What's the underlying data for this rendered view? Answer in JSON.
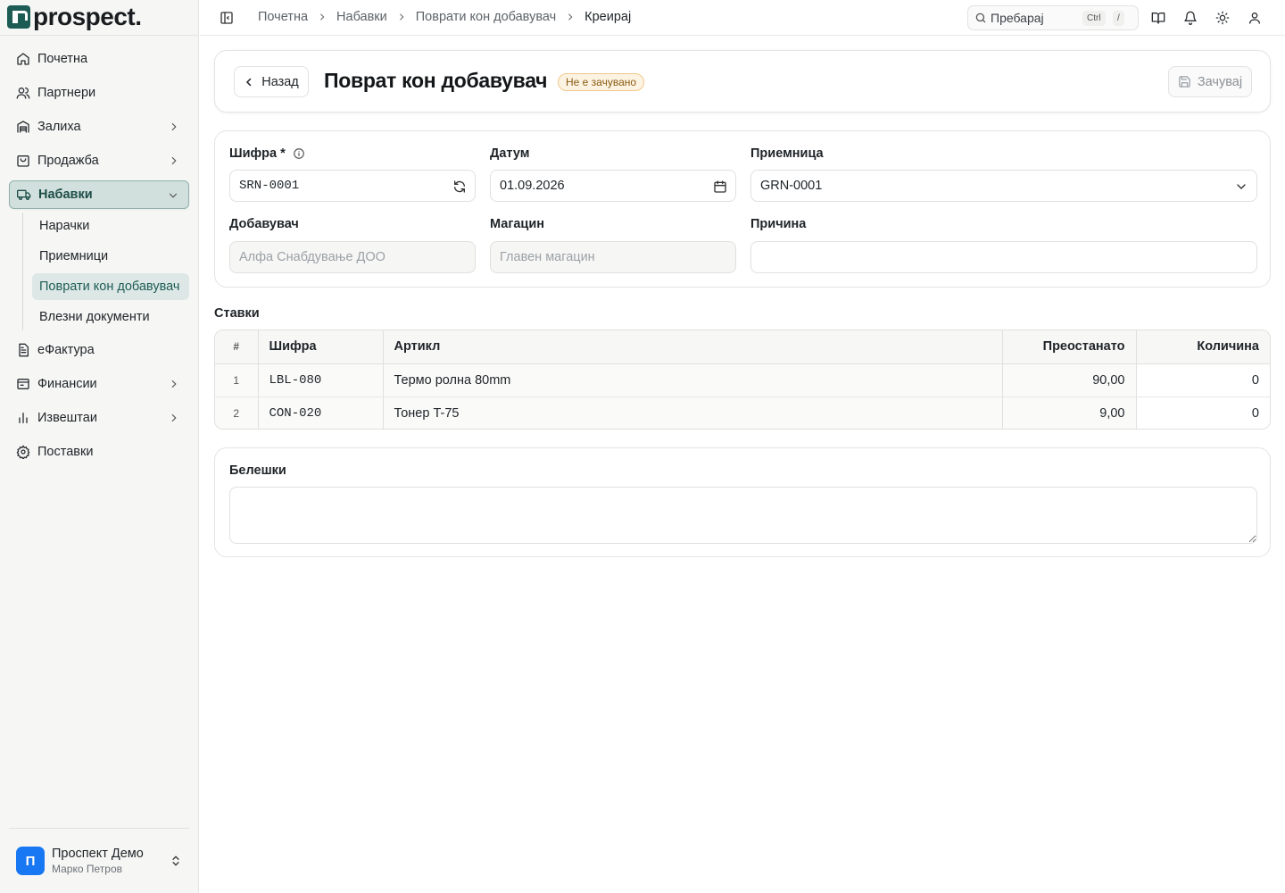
{
  "app": {
    "name": "prospect."
  },
  "sidebar": {
    "items": [
      {
        "label": "Почетна",
        "icon": "home-icon"
      },
      {
        "label": "Партнери",
        "icon": "users-icon"
      },
      {
        "label": "Залиха",
        "icon": "warehouse-icon"
      },
      {
        "label": "Продажба",
        "icon": "shopping-bag-icon"
      },
      {
        "label": "Набавки",
        "icon": "truck-icon"
      },
      {
        "label": "еФактура",
        "icon": "file-text-icon"
      },
      {
        "label": "Финансии",
        "icon": "wallet-icon"
      },
      {
        "label": "Извештаи",
        "icon": "bar-chart-icon"
      },
      {
        "label": "Поставки",
        "icon": "settings-icon"
      }
    ],
    "procurement_sub": [
      {
        "label": "Нарачки"
      },
      {
        "label": "Приемници"
      },
      {
        "label": "Поврати кон добавувач"
      },
      {
        "label": "Влезни документи"
      }
    ],
    "account": {
      "name": "Проспект Демо",
      "user": "Марко Петров",
      "initial": "П"
    }
  },
  "topbar": {
    "breadcrumbs": [
      "Почетна",
      "Набавки",
      "Поврати кон добавувач",
      "Креирај"
    ],
    "search_placeholder": "Пребарај",
    "kbd_ctrl": "Ctrl",
    "kbd_slash": "/"
  },
  "header": {
    "back_label": "Назад",
    "title": "Поврат кон добавувач",
    "status_badge": "Не е зачувано",
    "save_label": "Зачувај"
  },
  "form": {
    "code_label": "Шифра *",
    "code_value": "SRN-0001",
    "date_label": "Датум",
    "date_value": "01.09.2026",
    "grn_label": "Приемница",
    "grn_value": "GRN-0001",
    "supplier_label": "Добавувач",
    "supplier_value": "Алфа Снабдување ДОО",
    "warehouse_label": "Магацин",
    "warehouse_value": "Главен магацин",
    "reason_label": "Причина",
    "reason_value": ""
  },
  "items": {
    "section_label": "Ставки",
    "columns": [
      "#",
      "Шифра",
      "Артикл",
      "Преостанато",
      "Количина"
    ],
    "rows": [
      {
        "idx": "1",
        "code": "LBL-080",
        "article": "Термо ролна 80mm",
        "remaining": "90,00",
        "qty": "0"
      },
      {
        "idx": "2",
        "code": "CON-020",
        "article": "Тонер T-75",
        "remaining": "9,00",
        "qty": "0"
      }
    ]
  },
  "notes": {
    "label": "Белешки",
    "value": ""
  },
  "colors": {
    "accent": "#1d5c55",
    "active_bg": "#d2e0dd",
    "badge_bg": "#fdf3e3",
    "avatar": "#1877f2"
  }
}
